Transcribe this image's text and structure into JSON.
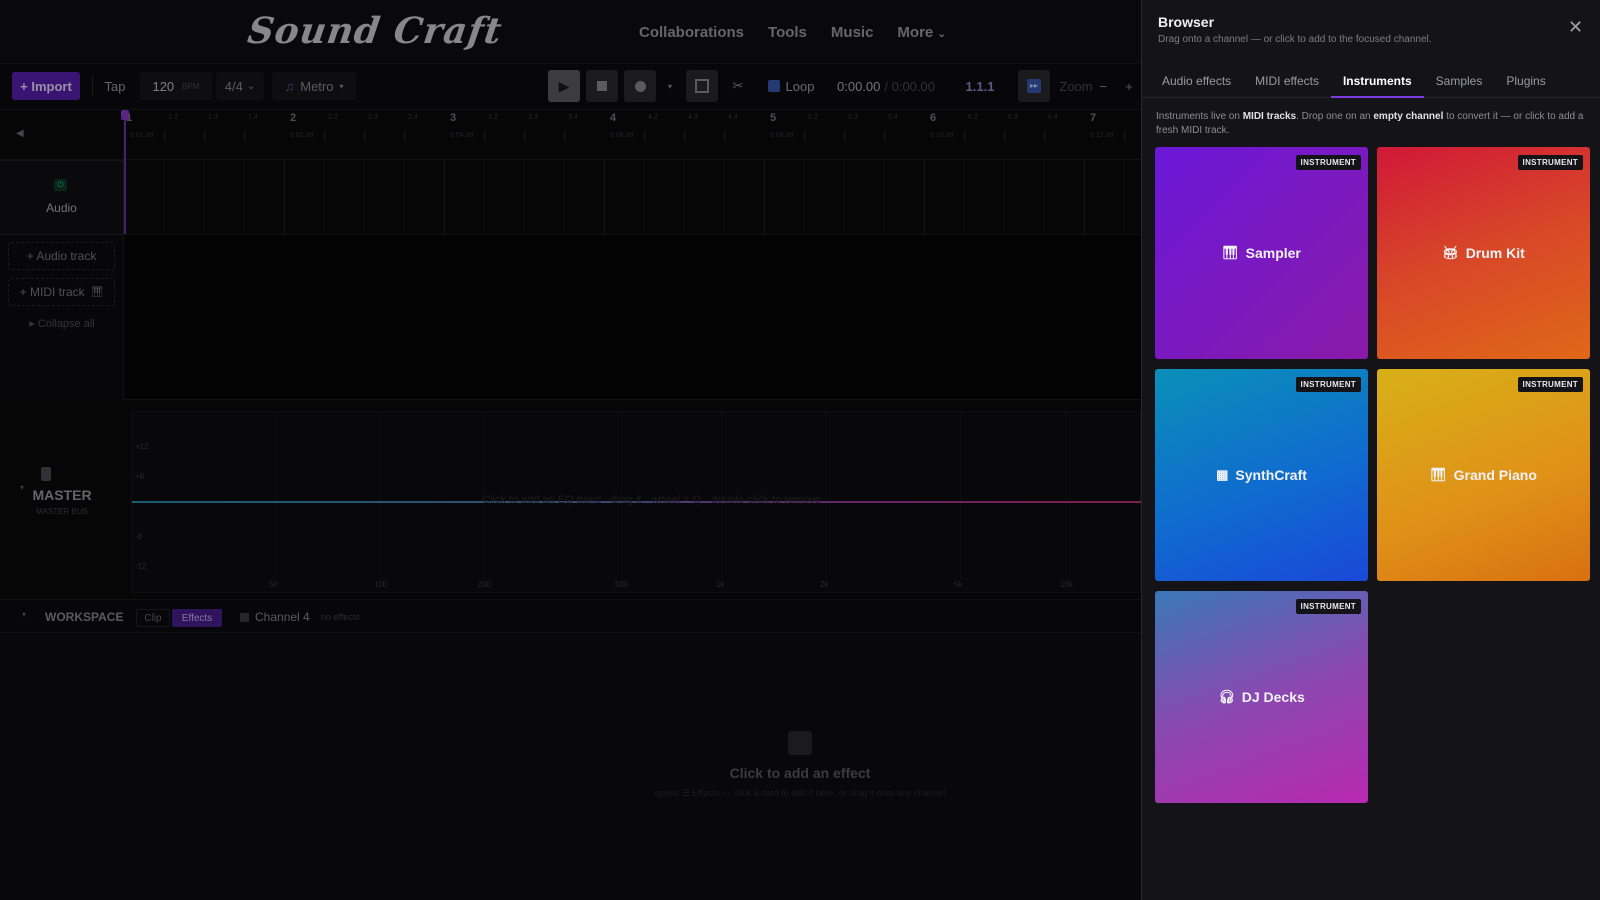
{
  "header": {
    "logo": "Sound Craft",
    "nav": [
      "Collaborations",
      "Tools",
      "Music",
      "More"
    ]
  },
  "toolbar": {
    "import_label": "+ Import",
    "tap_label": "Tap",
    "bpm_value": "120",
    "bpm_unit": "BPM",
    "time_signature": "4/4",
    "metronome_label": "Metro",
    "loop_label": "Loop",
    "time_current": "0:00.00",
    "time_total": "/ 0:00.00",
    "position": "1.1.1",
    "zoom_label": "Zoom",
    "zoom_minus": "−",
    "zoom_plus": "+"
  },
  "ruler": {
    "bars": [
      "1",
      "2",
      "3",
      "4",
      "5",
      "6",
      "7"
    ],
    "subs": [
      "1.2",
      "1.3",
      "1.4",
      "2.2",
      "2.3",
      "2.4",
      "3.2",
      "3.3",
      "3.4",
      "4.2",
      "4.3",
      "4.4",
      "5.2",
      "5.3",
      "5.4",
      "6.2",
      "6.3",
      "6.4"
    ],
    "times": [
      "0:01.00",
      "0:02.00",
      "0:04.00",
      "0:06.00",
      "0:08.00",
      "0:10.00",
      "0:12.00"
    ]
  },
  "tracks": {
    "track_name": "Audio",
    "add_audio": "+ Audio track",
    "add_midi": "+ MIDI track",
    "collapse": "Collapse all"
  },
  "master": {
    "title": "MASTER",
    "subtitle": "MASTER BUS",
    "eq_hint": "Click to add an EQ band · drag it · wheel = Q · double-click to remove",
    "db_labels": [
      "+12",
      "+6",
      "-6",
      "-12"
    ],
    "freq_labels": [
      "50",
      "100",
      "200",
      "500",
      "1k",
      "2k",
      "5k",
      "10k"
    ]
  },
  "workspace": {
    "title": "WORKSPACE",
    "tab_clip": "Clip",
    "tab_effects": "Effects",
    "channel": "Channel 4",
    "channel_status": "no effects",
    "empty_title": "Click to add an effect",
    "empty_sub": "opens ☰ Effects — click a card to add it here, or drag it onto any channel"
  },
  "browser": {
    "title": "Browser",
    "subtitle": "Drag onto a channel — or click to add to the focused channel.",
    "tabs": [
      "Audio effects",
      "MIDI effects",
      "Instruments",
      "Samples",
      "Plugins"
    ],
    "info_pre": "Instruments live on ",
    "info_b1": "MIDI tracks",
    "info_mid": ". Drop one on an ",
    "info_b2": "empty channel",
    "info_post": " to convert it — or click to add a fresh MIDI track.",
    "badge": "INSTRUMENT",
    "cards": [
      {
        "name": "Sampler",
        "icon": "piano-icon"
      },
      {
        "name": "Drum Kit",
        "icon": "drum-icon"
      },
      {
        "name": "SynthCraft",
        "icon": "synth-icon"
      },
      {
        "name": "Grand Piano",
        "icon": "piano-icon"
      },
      {
        "name": "DJ Decks",
        "icon": "headphones-icon"
      }
    ]
  },
  "colors": {
    "accent": "#7a3ae0",
    "import_bg": "#5a1fb0",
    "sampler": "#7a20c8",
    "drum_kit": "#d8402a",
    "synthcraft": "#1068c8",
    "grand_piano": "#e09818",
    "dj_decks": "#9a40b8"
  }
}
